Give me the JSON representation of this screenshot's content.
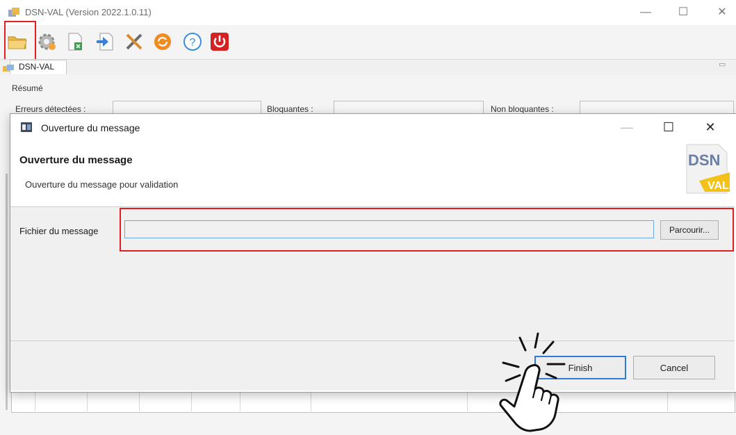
{
  "window": {
    "title": "DSN-VAL (Version  2022.1.0.11)",
    "controls": {
      "minimize": "—",
      "maximize": "☐",
      "close": "✕"
    }
  },
  "toolbar": {
    "icons": [
      "open-folder-icon",
      "settings-gear-icon",
      "export-document-icon",
      "import-arrow-icon",
      "tools-icon",
      "refresh-icon",
      "help-icon",
      "power-icon"
    ]
  },
  "view": {
    "tab_label": "DSN-VAL"
  },
  "summary": {
    "section_label": "Résumé",
    "errors_label": "Erreurs détectées :",
    "blocking_label": "Bloquantes :",
    "non_blocking_label": "Non bloquantes :"
  },
  "dialog": {
    "title": "Ouverture du message",
    "heading": "Ouverture du message",
    "description": "Ouverture du message pour validation",
    "logo_text_top": "DSN",
    "logo_text_bottom": "VAL",
    "file_label": "Fichier du message",
    "file_value": "",
    "browse_label": "Parcourir...",
    "finish_label": "Finish",
    "cancel_label": "Cancel",
    "controls": {
      "minimize": "—",
      "maximize": "☐",
      "close": "✕"
    }
  },
  "colors": {
    "highlight": "#e02020",
    "focus_blue": "#2f7ad3",
    "logo_yellow": "#f2c21b"
  }
}
